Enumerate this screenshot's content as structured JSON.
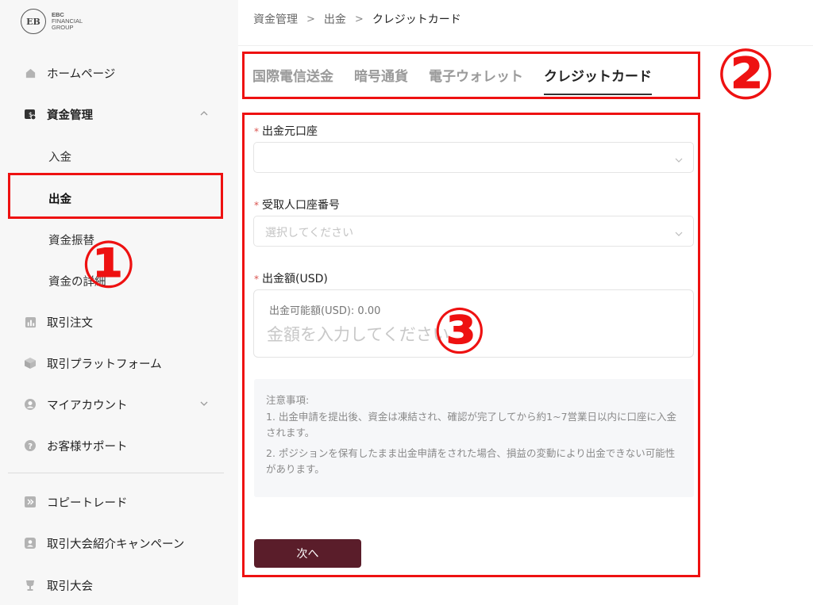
{
  "logo": {
    "mark": "EB",
    "line1": "EBC",
    "line2": "FINANCIAL",
    "line3": "GROUP"
  },
  "sidebar": {
    "items": [
      {
        "label": "ホームページ",
        "icon": "home-icon"
      },
      {
        "label": "資金管理",
        "icon": "wallet-icon"
      },
      {
        "label": "取引注文",
        "icon": "chart-icon"
      },
      {
        "label": "取引プラットフォーム",
        "icon": "cube-icon"
      },
      {
        "label": "マイアカウント",
        "icon": "user-icon"
      },
      {
        "label": "お客様サポート",
        "icon": "help-icon"
      },
      {
        "label": "コピートレード",
        "icon": "copy-trade-icon"
      },
      {
        "label": "取引大会紹介キャンペーン",
        "icon": "referral-icon"
      },
      {
        "label": "取引大会",
        "icon": "trophy-icon"
      }
    ],
    "sub_items": [
      {
        "label": "入金"
      },
      {
        "label": "出金"
      },
      {
        "label": "資金振替"
      },
      {
        "label": "資金の詳細"
      }
    ]
  },
  "breadcrumb": [
    "資金管理",
    "出金",
    "クレジットカード"
  ],
  "tabs": [
    "国際電信送金",
    "暗号通貨",
    "電子ウォレット",
    "クレジットカード"
  ],
  "form": {
    "source_account_label": "出金元口座",
    "source_account_value": "",
    "recipient_label": "受取人口座番号",
    "recipient_placeholder": "選択してください",
    "amount_label": "出金額(USD)",
    "available_text": "出金可能額(USD): 0.00",
    "amount_placeholder": "金額を入力してください"
  },
  "notice": {
    "title": "注意事項:",
    "item1": "1. 出金申請を提出後、資金は凍結され、確認が完了してから約1~7営業日以内に口座に入金されます。",
    "item2": "2. ポジションを保有したまま出金申請をされた場合、損益の変動により出金できない可能性があります。"
  },
  "next_button": "次へ",
  "annotations": {
    "n1": "①",
    "n2": "②",
    "n3": "③"
  },
  "colors": {
    "accent": "#5a1d2a",
    "annotation": "#ee1111",
    "sidebar_bg": "#f7f7f7"
  }
}
